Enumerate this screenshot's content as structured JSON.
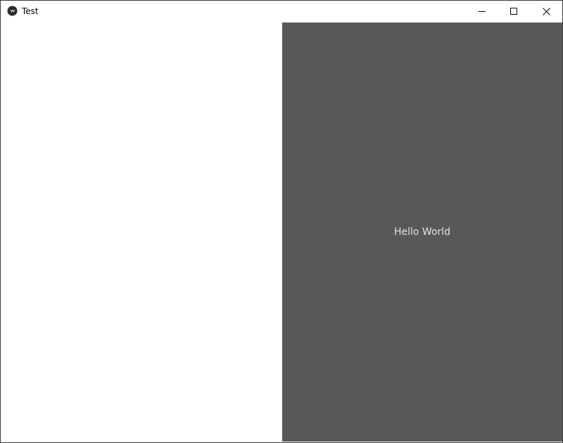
{
  "window": {
    "title": "Test",
    "icon": "kivy-logo-icon",
    "controls": {
      "minimize_icon": "minimize-icon",
      "maximize_icon": "maximize-icon",
      "close_icon": "close-icon"
    }
  },
  "panel": {
    "label": "Hello World",
    "background": "#585858",
    "text_color": "#e2e2e2"
  }
}
